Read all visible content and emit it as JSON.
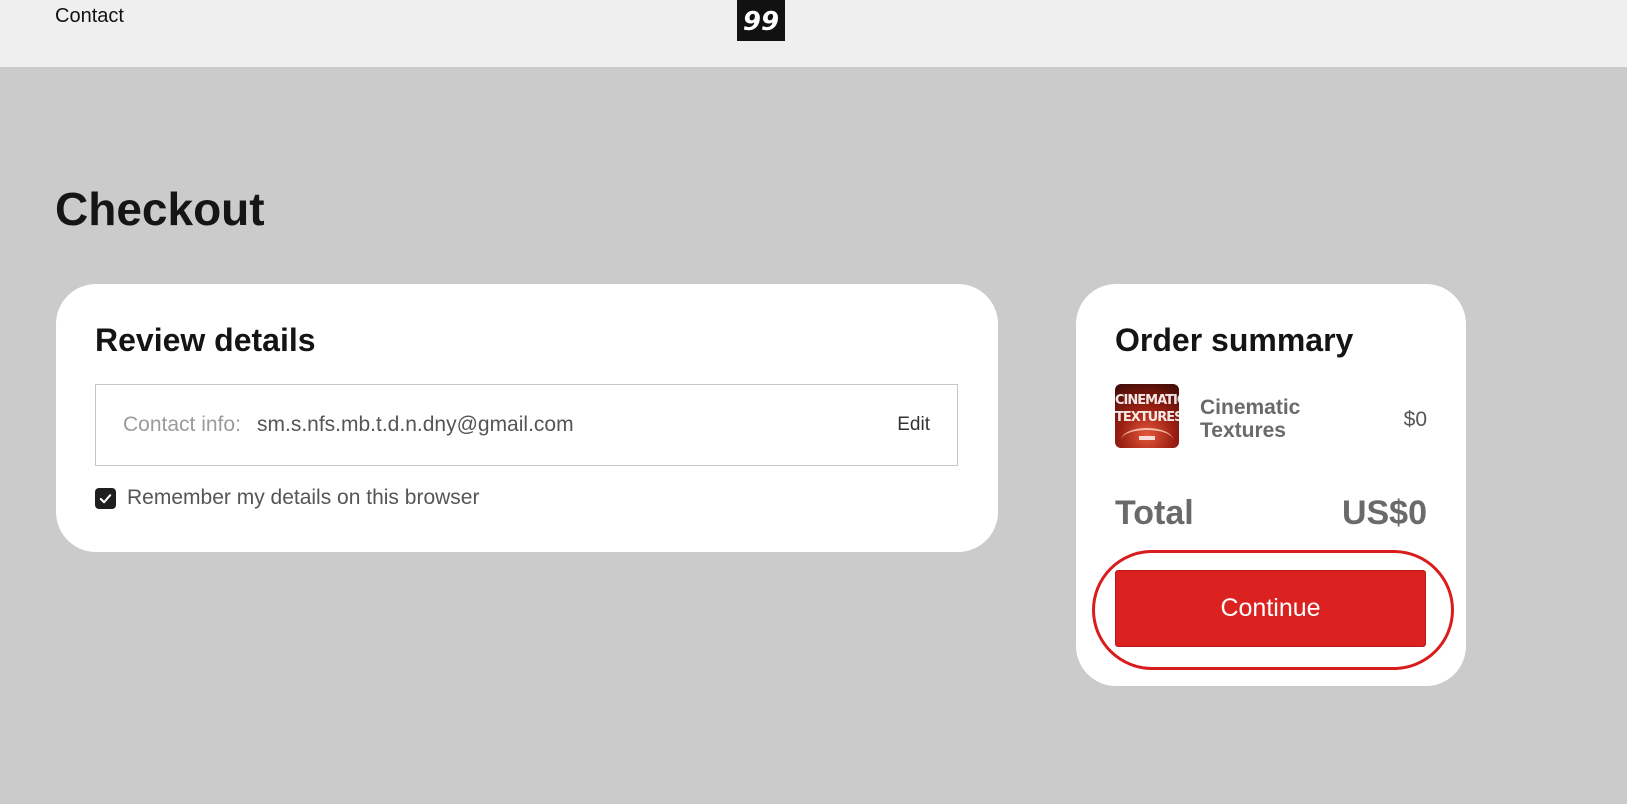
{
  "header": {
    "nav_contact": "Contact",
    "logo_text": "99"
  },
  "page": {
    "title": "Checkout"
  },
  "review": {
    "title": "Review details",
    "contact_label": "Contact info:",
    "contact_email": "sm.s.nfs.mb.t.d.n.dny@gmail.com",
    "edit_label": "Edit",
    "remember_label": "Remember my details on this browser",
    "remember_checked": true
  },
  "summary": {
    "title": "Order summary",
    "item": {
      "name": "Cinematic Textures",
      "price": "$0",
      "thumbnail_text": "CINEMATIC TEXTURES"
    },
    "total_label": "Total",
    "total_value": "US$0",
    "continue_label": "Continue"
  },
  "colors": {
    "accent": "#dc2121",
    "page_bg": "#cbcbcb",
    "header_bg": "#efefef"
  }
}
